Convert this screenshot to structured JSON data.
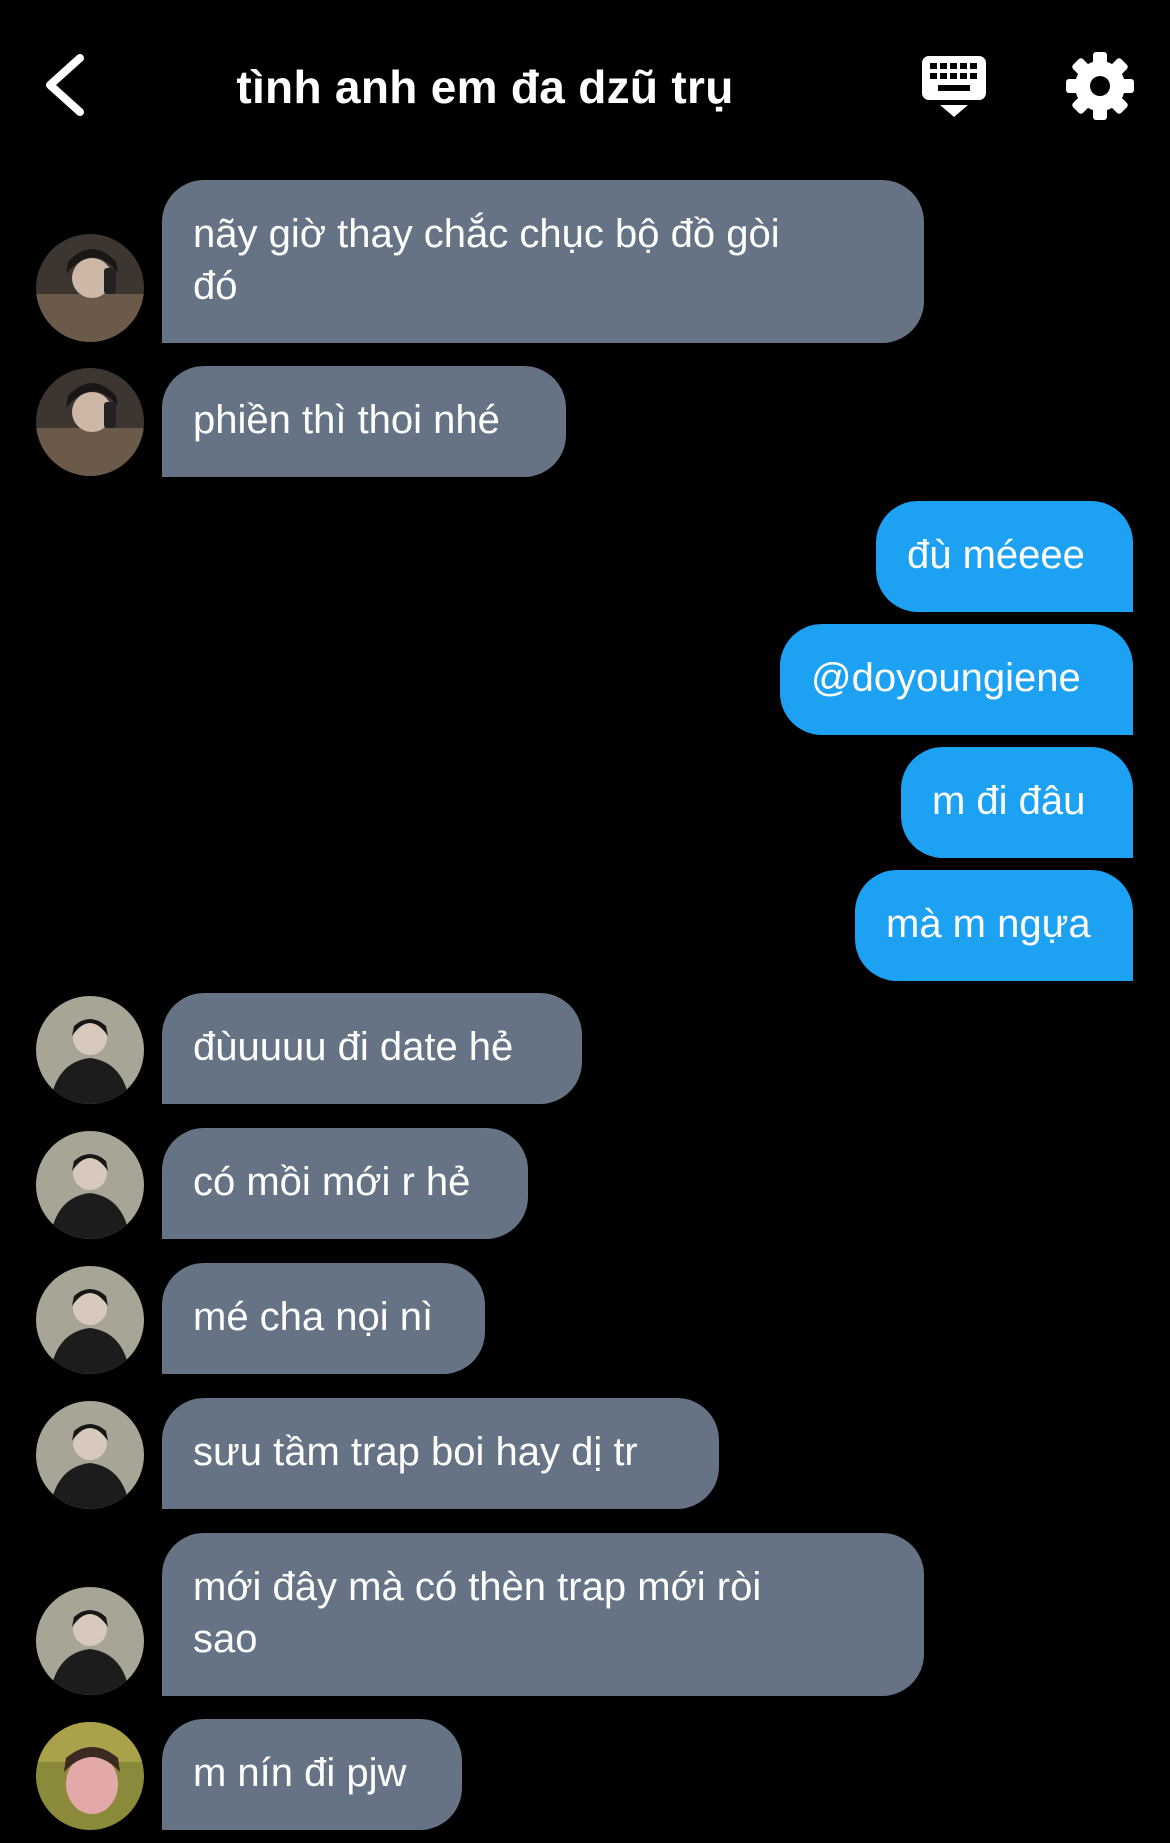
{
  "header": {
    "title": "tình anh em đa dzũ trụ",
    "back_icon": "chevron-left-icon",
    "keyboard_icon": "keyboard-icon",
    "settings_icon": "gear-icon"
  },
  "colors": {
    "background": "#000000",
    "incoming_bubble": "#657385",
    "outgoing_bubble": "#1da1f2",
    "text": "#ffffff"
  },
  "messages": [
    {
      "direction": "incoming",
      "avatar": "user-a-avatar",
      "text": "nãy giờ thay chắc chục bộ đồ gòi\nđó"
    },
    {
      "direction": "incoming",
      "avatar": "user-a-avatar",
      "text": "phiền thì thoi nhé"
    },
    {
      "direction": "outgoing",
      "text": "đù méeee"
    },
    {
      "direction": "outgoing",
      "text": "@doyoungiene"
    },
    {
      "direction": "outgoing",
      "text": "m đi đâu"
    },
    {
      "direction": "outgoing",
      "text": "mà m ngựa"
    },
    {
      "direction": "incoming",
      "avatar": "user-b-avatar",
      "text": "đùuuuu đi date hẻ"
    },
    {
      "direction": "incoming",
      "avatar": "user-b-avatar",
      "text": "có mồi mới r hẻ"
    },
    {
      "direction": "incoming",
      "avatar": "user-b-avatar",
      "text": "mé cha nọi nì"
    },
    {
      "direction": "incoming",
      "avatar": "user-b-avatar",
      "text": "sưu tầm trap boi hay dị tr"
    },
    {
      "direction": "incoming",
      "avatar": "user-b-avatar",
      "text": "mới đây mà có thèn trap mới ròi\nsao"
    },
    {
      "direction": "incoming",
      "avatar": "user-c-avatar",
      "text": "m nín đi pjw"
    }
  ]
}
